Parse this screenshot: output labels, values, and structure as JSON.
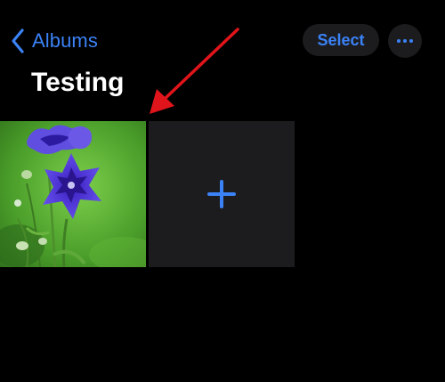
{
  "nav": {
    "back_label": "Albums",
    "select_label": "Select",
    "more_icon": "ellipsis-icon",
    "back_icon": "chevron-left-icon"
  },
  "album": {
    "title": "Testing"
  },
  "grid": {
    "photos": [
      {
        "icon": "photo-thumbnail",
        "subject": "purple-flower"
      }
    ],
    "add_icon": "plus-icon"
  },
  "annotation": {
    "icon": "red-arrow",
    "color": "#e0141b"
  },
  "colors": {
    "accent": "#3b82f6",
    "background": "#000000",
    "control_bg": "#1c1c1e",
    "text": "#ffffff"
  }
}
